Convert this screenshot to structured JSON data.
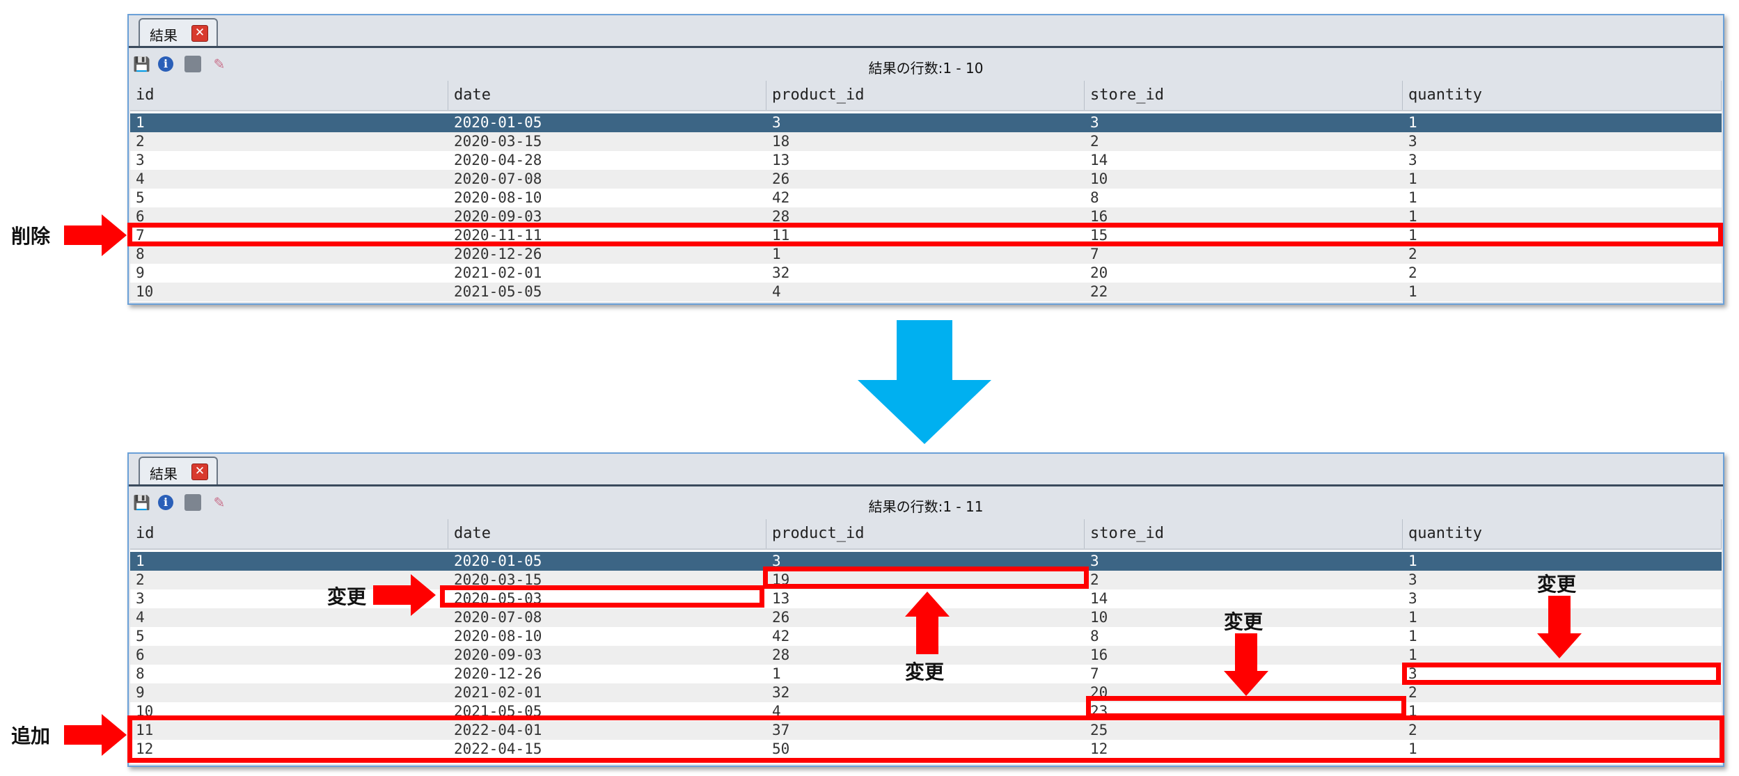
{
  "top": {
    "tab_label": "結果",
    "tab_close": "✕",
    "row_count": "結果の行数:1 - 10",
    "columns": [
      "id",
      "date",
      "product_id",
      "store_id",
      "quantity"
    ],
    "rows": [
      [
        "1",
        "2020-01-05",
        "3",
        "3",
        "1"
      ],
      [
        "2",
        "2020-03-15",
        "18",
        "2",
        "3"
      ],
      [
        "3",
        "2020-04-28",
        "13",
        "14",
        "3"
      ],
      [
        "4",
        "2020-07-08",
        "26",
        "10",
        "1"
      ],
      [
        "5",
        "2020-08-10",
        "42",
        "8",
        "1"
      ],
      [
        "6",
        "2020-09-03",
        "28",
        "16",
        "1"
      ],
      [
        "7",
        "2020-11-11",
        "11",
        "15",
        "1"
      ],
      [
        "8",
        "2020-12-26",
        "1",
        "7",
        "2"
      ],
      [
        "9",
        "2021-02-01",
        "32",
        "20",
        "2"
      ],
      [
        "10",
        "2021-05-05",
        "4",
        "22",
        "1"
      ]
    ],
    "selected_row": 0
  },
  "bottom": {
    "tab_label": "結果",
    "tab_close": "✕",
    "row_count": "結果の行数:1 - 11",
    "columns": [
      "id",
      "date",
      "product_id",
      "store_id",
      "quantity"
    ],
    "rows": [
      [
        "1",
        "2020-01-05",
        "3",
        "3",
        "1"
      ],
      [
        "2",
        "2020-03-15",
        "19",
        "2",
        "3"
      ],
      [
        "3",
        "2020-05-03",
        "13",
        "14",
        "3"
      ],
      [
        "4",
        "2020-07-08",
        "26",
        "10",
        "1"
      ],
      [
        "5",
        "2020-08-10",
        "42",
        "8",
        "1"
      ],
      [
        "6",
        "2020-09-03",
        "28",
        "16",
        "1"
      ],
      [
        "8",
        "2020-12-26",
        "1",
        "7",
        "3"
      ],
      [
        "9",
        "2021-02-01",
        "32",
        "20",
        "2"
      ],
      [
        "10",
        "2021-05-05",
        "4",
        "23",
        "1"
      ],
      [
        "11",
        "2022-04-01",
        "37",
        "25",
        "2"
      ],
      [
        "12",
        "2022-04-15",
        "50",
        "12",
        "1"
      ]
    ],
    "selected_row": 0
  },
  "annotations": {
    "delete": "削除",
    "change": "変更",
    "add": "追加"
  },
  "colors": {
    "highlight": "#ff0000",
    "transition_arrow": "#00b0f0",
    "selected_row": "#3c6585"
  },
  "icons": [
    "save-icon",
    "info-icon",
    "chat-icon",
    "eraser-icon",
    "close-icon"
  ]
}
